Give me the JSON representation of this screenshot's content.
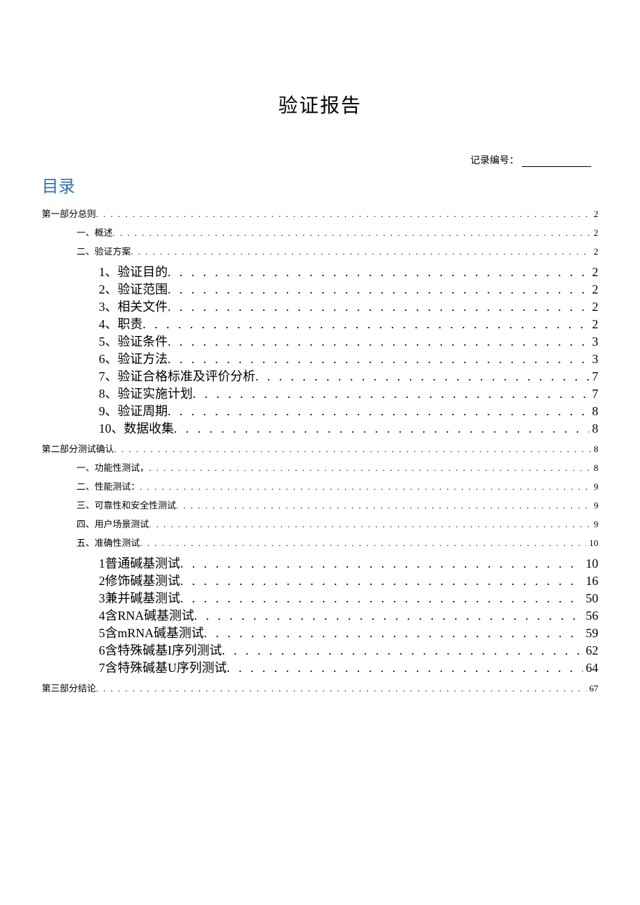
{
  "title": "验证报告",
  "record_label": "记录编号：",
  "toc_heading": "目录",
  "toc": [
    {
      "level": 1,
      "label": "第一部分总则",
      "page": "2"
    },
    {
      "level": 2,
      "label": "一、概述",
      "page": "2"
    },
    {
      "level": 2,
      "label": "二、验证方案",
      "page": "2"
    },
    {
      "level": 3,
      "label": "1、验证目的",
      "page": "2"
    },
    {
      "level": 3,
      "label": "2、验证范围",
      "page": "2"
    },
    {
      "level": 3,
      "label": "3、相关文件",
      "page": "2"
    },
    {
      "level": 3,
      "label": "4、职责",
      "page": "2"
    },
    {
      "level": 3,
      "label": "5、验证条件",
      "page": "3"
    },
    {
      "level": 3,
      "label": "6、验证方法",
      "page": "3"
    },
    {
      "level": 3,
      "label": "7、验证合格标准及评价分析",
      "page": "7"
    },
    {
      "level": 3,
      "label": "8、验证实施计划",
      "page": "7"
    },
    {
      "level": 3,
      "label": "9、验证周期",
      "page": "8"
    },
    {
      "level": 3,
      "label": "10、数据收集",
      "page": "8"
    },
    {
      "level": 1,
      "label": "第二部分测试确认",
      "page": "8"
    },
    {
      "level": 2,
      "label": "一、功能性测试，",
      "page": "8"
    },
    {
      "level": 2,
      "label": "二、性能测试：",
      "page": "9"
    },
    {
      "level": 2,
      "label": "三、可靠性和安全性测试",
      "page": "9"
    },
    {
      "level": 2,
      "label": "四、用户场景测试",
      "page": "9"
    },
    {
      "level": 2,
      "label": "五、准确性测试",
      "page": "10"
    },
    {
      "level": 3,
      "label": "1普通碱基测试",
      "page": "10"
    },
    {
      "level": 3,
      "label": "2修饰碱基测试",
      "page": "16"
    },
    {
      "level": 3,
      "label": "3兼并碱基测试",
      "page": "50"
    },
    {
      "level": 3,
      "label": "4含RNA碱基测试",
      "page": "56"
    },
    {
      "level": 3,
      "label": "5含mRNA碱基测试",
      "page": "59"
    },
    {
      "level": 3,
      "label": "6含特殊碱基I序列测试",
      "page": "62"
    },
    {
      "level": 3,
      "label": "7含特殊碱基U序列测试",
      "page": "64"
    },
    {
      "level": 1,
      "label": "第三部分结论",
      "page": "67"
    }
  ]
}
